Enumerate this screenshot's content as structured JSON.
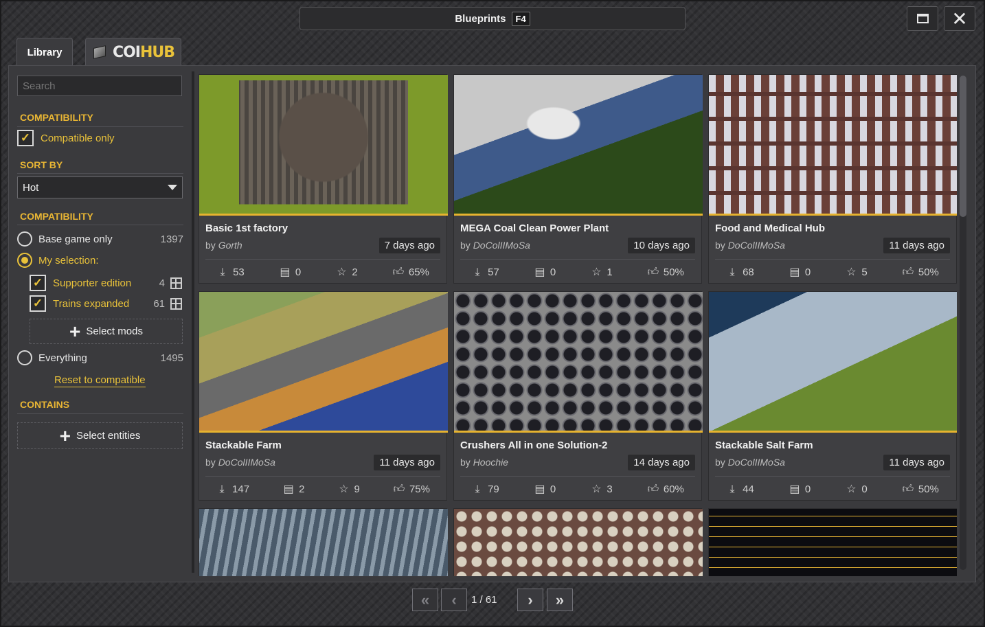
{
  "window": {
    "title": "Blueprints",
    "hotkey": "F4",
    "maximize_glyph": "maximize-icon",
    "close_glyph": "✕"
  },
  "tabs": {
    "library": "Library",
    "hub_logo_main": "COI",
    "hub_logo_accent": "HUB"
  },
  "search": {
    "placeholder": "Search"
  },
  "filters": {
    "compat_title": "COMPATIBILITY",
    "compatible_only": "Compatible only",
    "sort_title": "SORT BY",
    "sort_value": "Hot",
    "compat2_title": "COMPATIBILITY",
    "base_game": {
      "label": "Base game only",
      "count": "1397"
    },
    "my_selection": {
      "label": "My selection:"
    },
    "mods": [
      {
        "label": "Supporter edition",
        "count": "4"
      },
      {
        "label": "Trains expanded",
        "count": "61"
      }
    ],
    "select_mods": "Select mods",
    "everything": {
      "label": "Everything",
      "count": "1495"
    },
    "reset": "Reset to compatible",
    "contains_title": "CONTAINS",
    "select_entities": "Select entities"
  },
  "cards": [
    {
      "title": "Basic 1st factory",
      "by": "by",
      "author": "Gorth",
      "age": "7 days ago",
      "downloads": "53",
      "comments": "0",
      "stars": "2",
      "likes": "65%"
    },
    {
      "title": "MEGA Coal Clean Power Plant",
      "by": "by",
      "author": "DoColIIMoSa",
      "age": "10 days ago",
      "downloads": "57",
      "comments": "0",
      "stars": "1",
      "likes": "50%"
    },
    {
      "title": "Food and Medical Hub",
      "by": "by",
      "author": "DoColIIMoSa",
      "age": "11 days ago",
      "downloads": "68",
      "comments": "0",
      "stars": "5",
      "likes": "50%"
    },
    {
      "title": "Stackable Farm",
      "by": "by",
      "author": "DoColIIMoSa",
      "age": "11 days ago",
      "downloads": "147",
      "comments": "2",
      "stars": "9",
      "likes": "75%"
    },
    {
      "title": "Crushers All in one Solution-2",
      "by": "by",
      "author": "Hoochie",
      "age": "14 days ago",
      "downloads": "79",
      "comments": "0",
      "stars": "3",
      "likes": "60%"
    },
    {
      "title": "Stackable Salt Farm",
      "by": "by",
      "author": "DoColIIMoSa",
      "age": "11 days ago",
      "downloads": "44",
      "comments": "0",
      "stars": "0",
      "likes": "50%"
    }
  ],
  "pager": {
    "first": "«",
    "prev": "‹",
    "label": "1 / 61",
    "next": "›",
    "last": "»"
  },
  "colors": {
    "accent": "#e9b634",
    "panel": "#3a3a3d",
    "card": "#3f3f42"
  }
}
